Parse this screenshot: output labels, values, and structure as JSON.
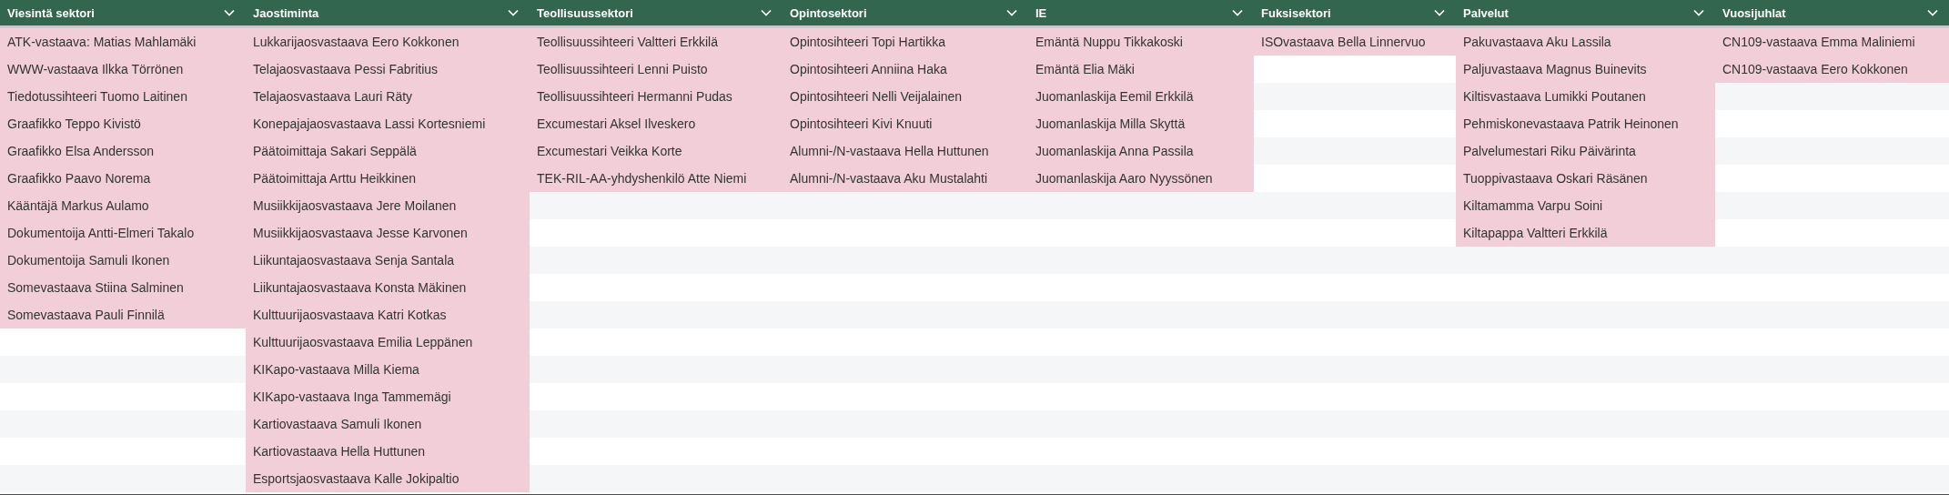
{
  "table": {
    "columns": [
      {
        "title": "Viesintä sektori",
        "cells": [
          "ATK-vastaava: Matias Mahlamäki",
          "WWW-vastaava Ilkka Törrönen",
          "Tiedotussihteeri Tuomo Laitinen",
          "Graafikko Teppo Kivistö",
          "Graafikko Elsa Andersson",
          "Graafikko Paavo Norema",
          "Kääntäjä Markus Aulamo",
          "Dokumentoija Antti-Elmeri Takalo",
          "Dokumentoija Samuli Ikonen",
          "Somevastaava Stiina Salminen",
          "Somevastaava Pauli Finnilä"
        ]
      },
      {
        "title": "Jaostiminta",
        "cells": [
          "Lukkarijaosvastaava Eero Kokkonen",
          "Telajaosvastaava Pessi Fabritius",
          "Telajaosvastaava Lauri Räty",
          "Konepajajaosvastaava Lassi Kortesniemi",
          "Päätoimittaja Sakari Seppälä",
          "Päätoimittaja Arttu Heikkinen",
          "Musiikkijaosvastaava Jere Moilanen",
          "Musiikkijaosvastaava Jesse Karvonen",
          "Liikuntajaosvastaava Senja Santala",
          "Liikuntajaosvastaava Konsta Mäkinen",
          "Kulttuurijaosvastaava Katri Kotkas",
          "Kulttuurijaosvastaava Emilia Leppänen",
          "KIKapo-vastaava Milla Kiema",
          "KIKapo-vastaava Inga Tammemägi",
          "Kartiovastaava Samuli Ikonen",
          "Kartiovastaava Hella Huttunen",
          "Esportsjaosvastaava Kalle Jokipaltio"
        ]
      },
      {
        "title": "Teollisuussektori",
        "cells": [
          "Teollisuussihteeri Valtteri Erkkilä",
          "Teollisuussihteeri Lenni Puisto",
          "Teollisuussihteeri Hermanni Pudas",
          "Excumestari Aksel Ilveskero",
          "Excumestari Veikka Korte",
          "TEK-RIL-AA-yhdyshenkilö Atte Niemi"
        ]
      },
      {
        "title": "Opintosektori",
        "cells": [
          "Opintosihteeri Topi Hartikka",
          "Opintosihteeri Anniina Haka",
          "Opintosihteeri Nelli Veijalainen",
          "Opintosihteeri Kivi Knuuti",
          "Alumni-/N-vastaava Hella Huttunen",
          "Alumni-/N-vastaava Aku Mustalahti"
        ]
      },
      {
        "title": "IE",
        "cells": [
          "Emäntä Nuppu Tikkakoski",
          "Emäntä Elia Mäki",
          "Juomanlaskija Eemil Erkkilä",
          "Juomanlaskija Milla Skyttä",
          "Juomanlaskija Anna Passila",
          "Juomanlaskija Aaro Nyyssönen"
        ]
      },
      {
        "title": "Fuksisektori",
        "cells": [
          "ISOvastaava Bella Linnervuo"
        ]
      },
      {
        "title": "Palvelut",
        "cells": [
          "Pakuvastaava Aku Lassila",
          "Paljuvastaava Magnus Buinevits",
          "Kiltisvastaava Lumikki Poutanen",
          "Pehmiskonevastaava Patrik Heinonen",
          "Palvelumestari Riku Päivärinta",
          "Tuoppivastaava Oskari Räsänen",
          "Kiltamamma Varpu Soini",
          "Kiltapappa Valtteri Erkkilä"
        ]
      },
      {
        "title": "Vuosijuhlat",
        "cells": [
          "CN109-vastaava Emma Maliniemi",
          "CN109-vastaava Eero Kokkonen"
        ]
      }
    ]
  }
}
